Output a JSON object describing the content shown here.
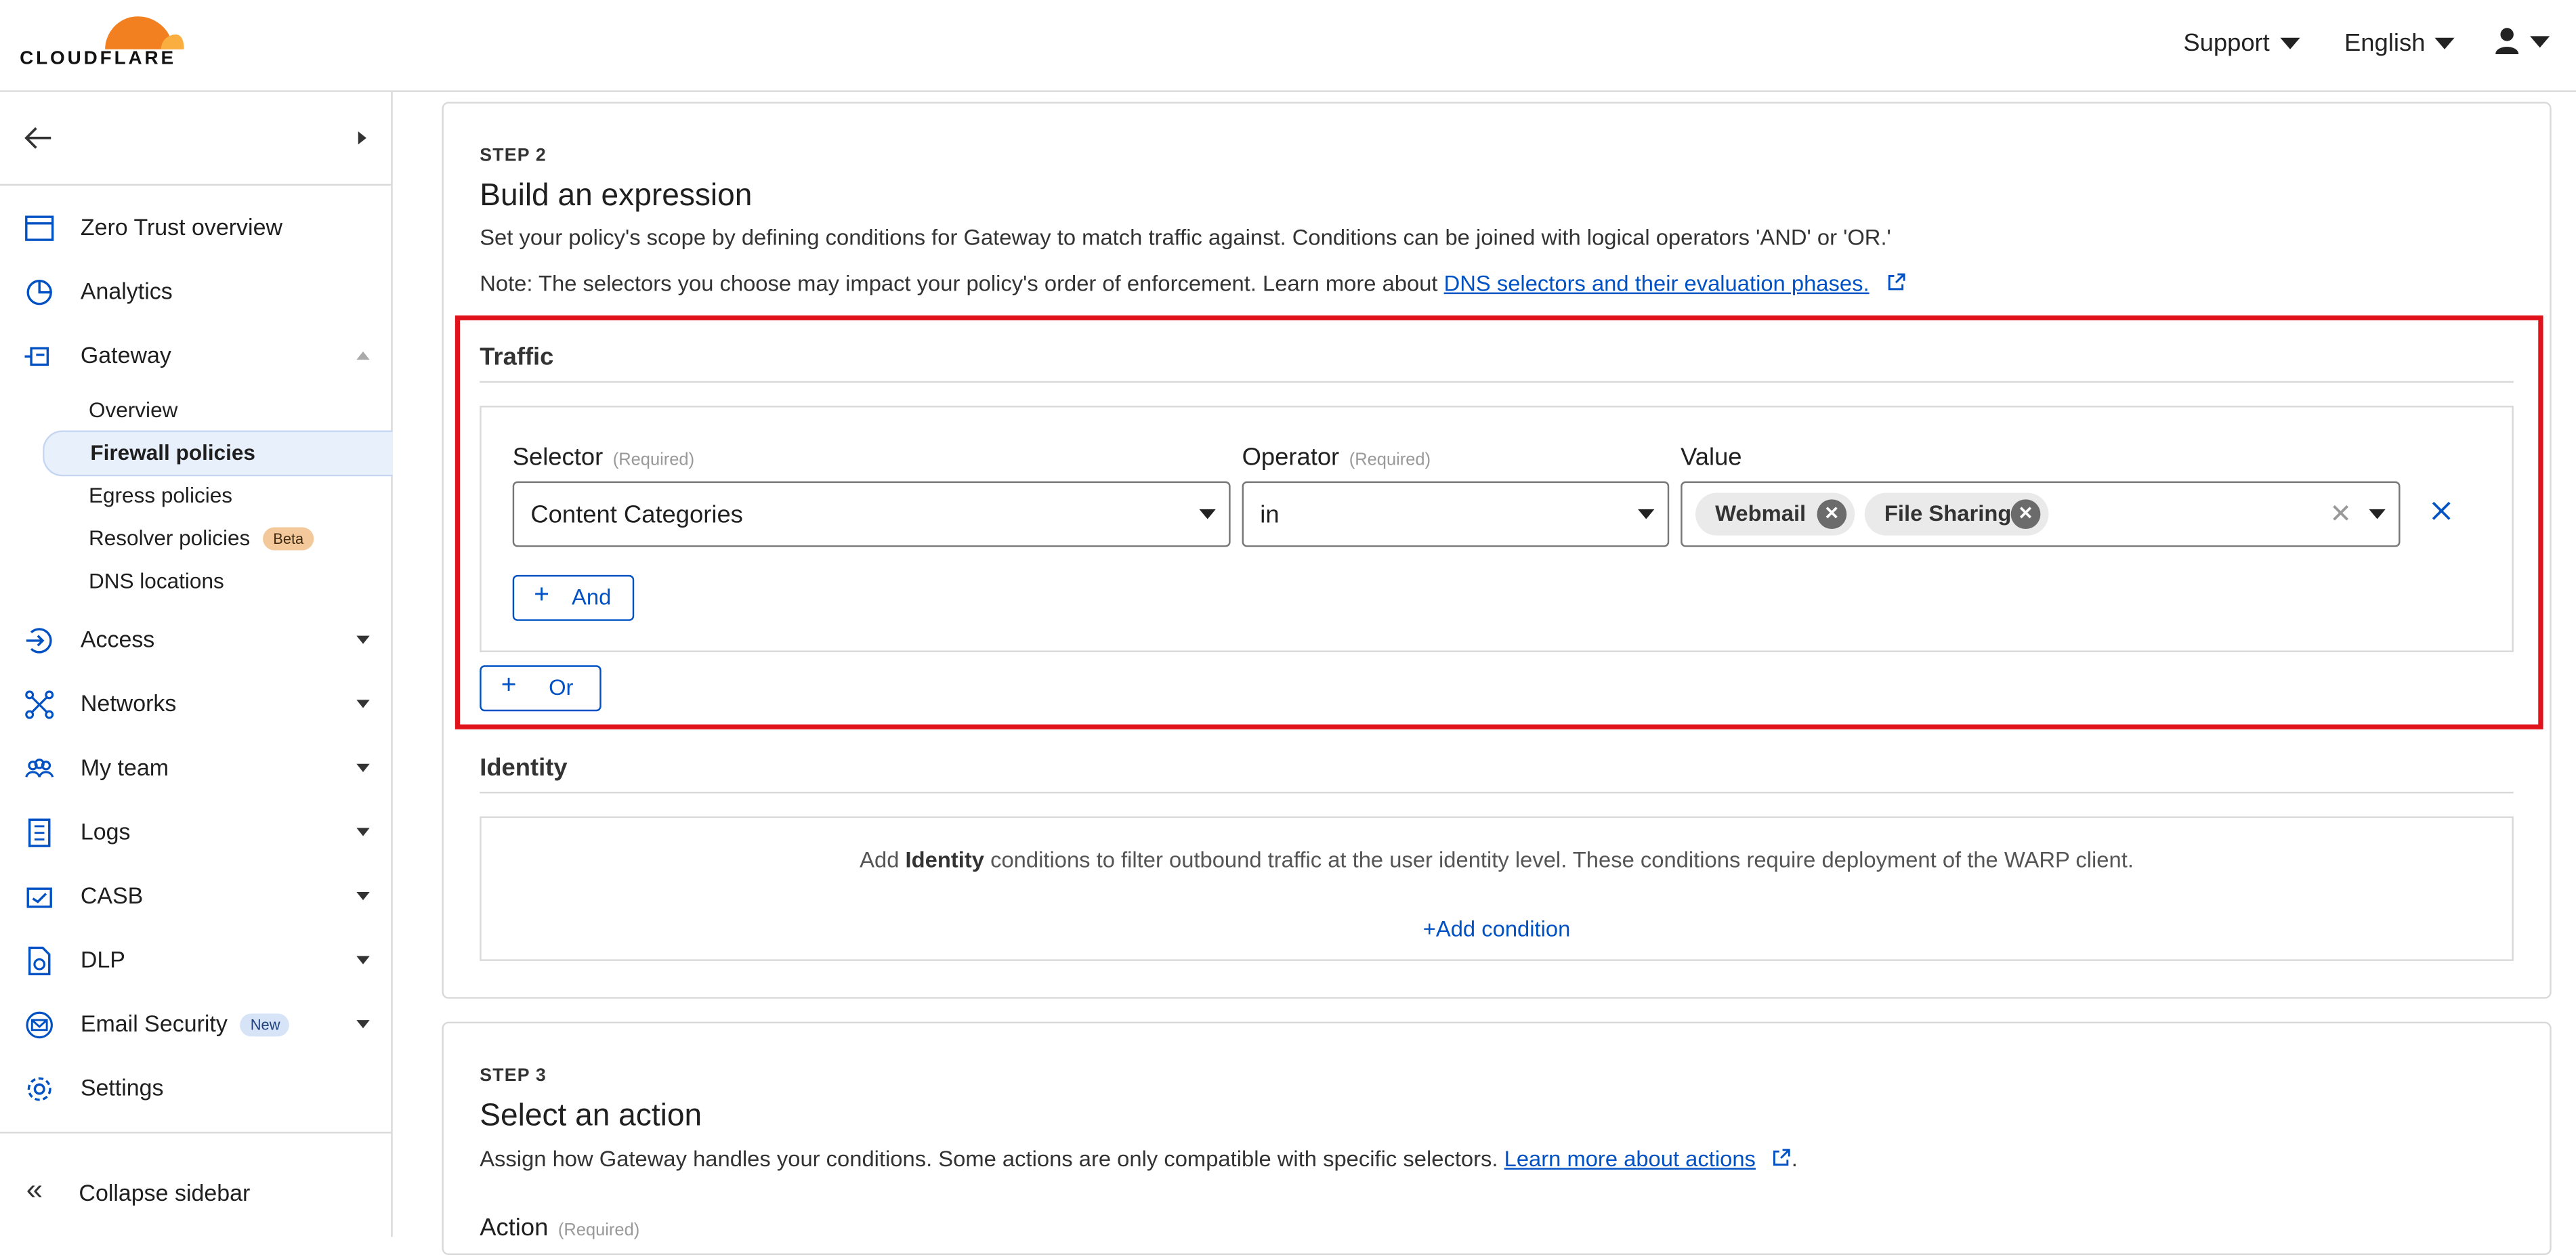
{
  "header": {
    "logo_text": "CLOUDFLARE",
    "support_label": "Support",
    "language_label": "English"
  },
  "sidebar": {
    "items": [
      {
        "label": "Zero Trust overview",
        "icon": "browser-window-icon"
      },
      {
        "label": "Analytics",
        "icon": "pie-chart-icon"
      },
      {
        "label": "Gateway",
        "icon": "gateway-icon"
      },
      {
        "label": "Access",
        "icon": "access-icon"
      },
      {
        "label": "Networks",
        "icon": "network-icon"
      },
      {
        "label": "My team",
        "icon": "team-icon"
      },
      {
        "label": "Logs",
        "icon": "logs-icon"
      },
      {
        "label": "CASB",
        "icon": "casb-icon"
      },
      {
        "label": "DLP",
        "icon": "dlp-icon"
      },
      {
        "label": "Email Security",
        "icon": "email-security-icon",
        "badge": "New"
      },
      {
        "label": "Settings",
        "icon": "gear-icon"
      }
    ],
    "gateway_sub": [
      {
        "label": "Overview"
      },
      {
        "label": "Firewall policies",
        "active": true
      },
      {
        "label": "Egress policies"
      },
      {
        "label": "Resolver policies",
        "badge": "Beta"
      },
      {
        "label": "DNS locations"
      }
    ],
    "collapse_label": "Collapse sidebar"
  },
  "step2": {
    "step_label": "STEP 2",
    "title": "Build an expression",
    "description": "Set your policy's scope by defining conditions for Gateway to match traffic against. Conditions can be joined with logical operators 'AND' or 'OR.'",
    "note_prefix": "Note: The selectors you choose may impact your policy's order of enforcement. Learn more about ",
    "note_link": "DNS selectors and their evaluation phases.",
    "traffic": {
      "title": "Traffic",
      "selector_label": "Selector",
      "selector_required": "(Required)",
      "selector_value": "Content Categories",
      "operator_label": "Operator",
      "operator_required": "(Required)",
      "operator_value": "in",
      "value_label": "Value",
      "value_chips": [
        "Webmail",
        "File Sharing"
      ],
      "and_label": "And",
      "or_label": "Or"
    },
    "identity": {
      "title": "Identity",
      "text_prefix": "Add ",
      "text_bold": "Identity",
      "text_suffix": " conditions to filter outbound traffic at the user identity level. These conditions require deployment of the WARP client.",
      "add_condition": "Add condition"
    }
  },
  "step3": {
    "step_label": "STEP 3",
    "title": "Select an action",
    "description_prefix": "Assign how Gateway handles your conditions. Some actions are only compatible with specific selectors. ",
    "description_link": "Learn more about actions",
    "action_label": "Action",
    "action_required": "(Required)"
  },
  "colors": {
    "accent": "#0051c3",
    "logo_orange": "#f38020",
    "highlight_red": "#e0131d"
  }
}
